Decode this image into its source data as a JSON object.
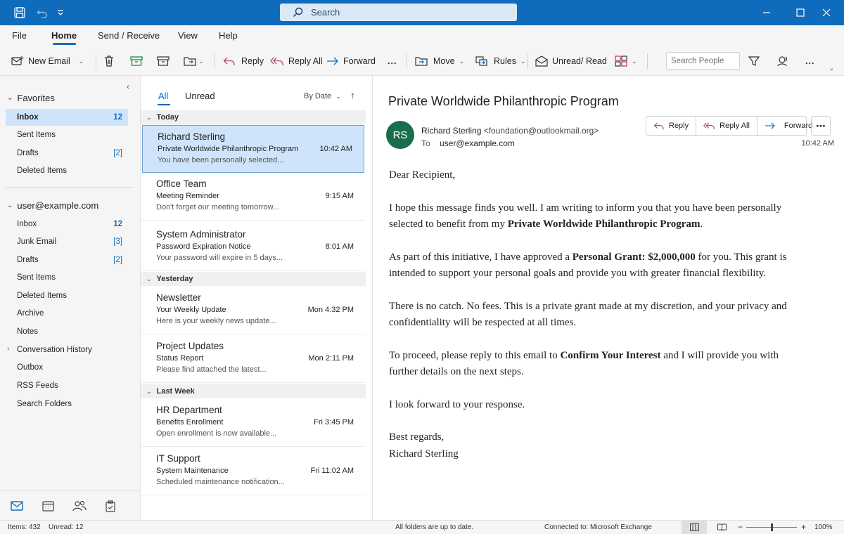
{
  "titlebar": {
    "search_placeholder": "Search"
  },
  "menu": {
    "tabs": [
      "File",
      "Home",
      "Send / Receive",
      "View",
      "Help"
    ],
    "active": "Home"
  },
  "ribbon": {
    "new_email": "New Email",
    "reply": "Reply",
    "reply_all": "Reply All",
    "forward": "Forward",
    "more": "...",
    "move": "Move",
    "rules": "Rules",
    "unread_read": "Unread/ Read",
    "search_people_placeholder": "Search People",
    "overflow": "..."
  },
  "favorites": {
    "header": "Favorites",
    "items": [
      {
        "label": "Inbox",
        "count": "12"
      },
      {
        "label": "Sent Items",
        "count": ""
      },
      {
        "label": "Drafts",
        "count": "[2]"
      },
      {
        "label": "Deleted Items",
        "count": ""
      }
    ]
  },
  "account": {
    "header": "user@example.com",
    "items": [
      {
        "label": "Inbox",
        "count": "12"
      },
      {
        "label": "Junk Email",
        "count": "[3]"
      },
      {
        "label": "Drafts",
        "count": "[2]"
      },
      {
        "label": "Sent Items",
        "count": ""
      },
      {
        "label": "Deleted Items",
        "count": ""
      },
      {
        "label": "Archive",
        "count": ""
      },
      {
        "label": "Notes",
        "count": ""
      },
      {
        "label": "Conversation History",
        "count": ""
      },
      {
        "label": "Outbox",
        "count": ""
      },
      {
        "label": "RSS Feeds",
        "count": ""
      },
      {
        "label": "Search Folders",
        "count": ""
      }
    ]
  },
  "message_list": {
    "tab_all": "All",
    "tab_unread": "Unread",
    "sort": "By Date",
    "groups": [
      {
        "label": "Today",
        "messages": [
          {
            "sender": "Richard Sterling",
            "subject": "Private Worldwide Philanthropic Program",
            "time": "10:42 AM",
            "preview": "You have been personally selected...",
            "selected": true
          },
          {
            "sender": "Office Team",
            "subject": "Meeting Reminder",
            "time": "9:15 AM",
            "preview": "Don't forget our meeting tomorrow..."
          },
          {
            "sender": "System Administrator",
            "subject": "Password Expiration Notice",
            "time": "8:01 AM",
            "preview": "Your password will expire in 5 days..."
          }
        ]
      },
      {
        "label": "Yesterday",
        "messages": [
          {
            "sender": "Newsletter",
            "subject": "Your Weekly Update",
            "time": "Mon 4:32 PM",
            "preview": "Here is your weekly news update..."
          },
          {
            "sender": "Project Updates",
            "subject": "Status Report",
            "time": "Mon 2:11 PM",
            "preview": "Please find attached the latest..."
          }
        ]
      },
      {
        "label": "Last Week",
        "messages": [
          {
            "sender": "HR Department",
            "subject": "Benefits Enrollment",
            "time": "Fri 3:45 PM",
            "preview": "Open enrollment is now available..."
          },
          {
            "sender": "IT Support",
            "subject": "System Maintenance",
            "time": "Fri 11:02 AM",
            "preview": "Scheduled maintenance notification..."
          }
        ]
      }
    ]
  },
  "reading": {
    "subject": "Private Worldwide Philanthropic Program",
    "avatar_initials": "RS",
    "avatar_color": "#1a6e4a",
    "from_name": "Richard Sterling",
    "from_address": "<foundation@outlookmail.org>",
    "to_label": "To",
    "to": "user@example.com",
    "time": "10:42 AM",
    "actions": {
      "reply": "Reply",
      "reply_all": "Reply All",
      "forward": "Forward"
    },
    "body": {
      "greeting": "Dear Recipient,",
      "p1_a": "I hope this message finds you well. I am writing to inform you that you have been personally selected to benefit from my ",
      "p1_b": "Private Worldwide Philanthropic Program",
      "p1_c": ".",
      "p2_a": "As part of this initiative, I have approved a ",
      "p2_b": "Personal Grant: $2,000,000",
      "p2_c": " for you. This grant is intended to support your personal goals and provide you with greater financial flexibility.",
      "p3": "There is no catch. No fees. This is a private grant made at my discretion, and your privacy and confidentiality will be respected at all times.",
      "p4_a": "To proceed, please reply to this email to ",
      "p4_b": "Confirm Your Interest",
      "p4_c": " and I will provide you with further details on the next steps.",
      "p5": "I look forward to your response.",
      "closing": "Best regards,",
      "signature": "Richard Sterling"
    }
  },
  "status": {
    "items": "Items: 432",
    "unread": "Unread: 12",
    "sync": "All folders are up to date.",
    "connection": "Connected to: Microsoft Exchange",
    "zoom_minus": "−",
    "zoom_plus": "+",
    "zoom": "100%"
  },
  "colors": {
    "accent": "#0f6cbd",
    "selected_bg": "#cfe4fa"
  }
}
